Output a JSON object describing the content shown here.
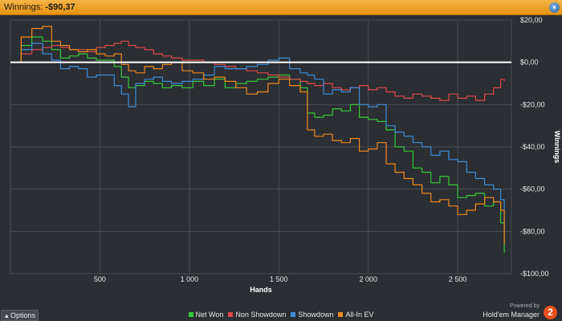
{
  "window": {
    "title_prefix": "Winnings: ",
    "title_value": "-$90,37"
  },
  "options_button": {
    "label": "Options",
    "icon": "caret-up-icon"
  },
  "branding": {
    "powered_by": "Powered by",
    "name": "Hold'em Manager",
    "logo_text": "2"
  },
  "chart_data": {
    "type": "line",
    "xlabel": "Hands",
    "ylabel": "Winnings",
    "xlim": [
      0,
      2800
    ],
    "ylim": [
      -100,
      20
    ],
    "x_ticks": [
      500,
      1000,
      1500,
      2000,
      2500
    ],
    "x_tick_labels": [
      "500",
      "1 000",
      "1 500",
      "2 000",
      "2 500"
    ],
    "y_ticks": [
      20,
      0,
      -20,
      -40,
      -60,
      -80,
      -100
    ],
    "y_tick_labels": [
      "$20,00",
      "$0,00",
      "-$20,00",
      "-$40,00",
      "-$60,00",
      "-$80,00",
      "-$100,00"
    ],
    "zero_line": true,
    "grid": true,
    "legend_position": "bottom",
    "series": [
      {
        "name": "Net Won",
        "color": "#36c93a",
        "x": [
          0,
          60,
          120,
          180,
          230,
          280,
          330,
          380,
          430,
          480,
          530,
          580,
          620,
          660,
          700,
          750,
          800,
          850,
          900,
          960,
          1020,
          1080,
          1140,
          1200,
          1260,
          1320,
          1380,
          1440,
          1500,
          1560,
          1620,
          1660,
          1700,
          1750,
          1800,
          1850,
          1900,
          1950,
          2000,
          2050,
          2100,
          2150,
          2200,
          2250,
          2300,
          2350,
          2400,
          2450,
          2500,
          2550,
          2600,
          2650,
          2700,
          2740,
          2760
        ],
        "y": [
          0,
          8,
          12,
          10,
          6,
          2,
          3,
          4,
          2,
          1,
          1,
          -2,
          -7,
          -12,
          -11,
          -9,
          -10,
          -12,
          -11,
          -12,
          -9,
          -11,
          -8,
          -12,
          -10,
          -9,
          -8,
          -7,
          -6,
          -8,
          -12,
          -24,
          -26,
          -25,
          -22,
          -23,
          -20,
          -26,
          -27,
          -28,
          -32,
          -40,
          -42,
          -50,
          -52,
          -57,
          -54,
          -58,
          -64,
          -63,
          -62,
          -68,
          -66,
          -76,
          -90
        ]
      },
      {
        "name": "Non Showdown",
        "color": "#e04a4a",
        "x": [
          0,
          60,
          120,
          180,
          230,
          280,
          330,
          380,
          430,
          480,
          530,
          580,
          620,
          660,
          700,
          750,
          800,
          850,
          900,
          960,
          1020,
          1080,
          1140,
          1200,
          1260,
          1320,
          1380,
          1440,
          1500,
          1560,
          1620,
          1660,
          1700,
          1750,
          1800,
          1850,
          1900,
          1950,
          2000,
          2050,
          2100,
          2150,
          2200,
          2250,
          2300,
          2350,
          2400,
          2450,
          2500,
          2550,
          2600,
          2650,
          2700,
          2740,
          2760
        ],
        "y": [
          0,
          4,
          6,
          7,
          8,
          7,
          6,
          6,
          5,
          7,
          8,
          9,
          10,
          8,
          7,
          6,
          4,
          3,
          2,
          1,
          1,
          0,
          -1,
          -2,
          -3,
          -4,
          -5,
          -6,
          -7,
          -8,
          -9,
          -10,
          -11,
          -10,
          -12,
          -13,
          -12,
          -11,
          -13,
          -12,
          -14,
          -16,
          -17,
          -15,
          -16,
          -17,
          -18,
          -15,
          -17,
          -16,
          -18,
          -15,
          -12,
          -8,
          -9
        ]
      },
      {
        "name": "Showdown",
        "color": "#3d8edb",
        "x": [
          0,
          60,
          120,
          180,
          230,
          280,
          330,
          380,
          430,
          480,
          530,
          580,
          620,
          660,
          700,
          750,
          800,
          850,
          900,
          960,
          1020,
          1080,
          1140,
          1200,
          1260,
          1320,
          1380,
          1440,
          1500,
          1560,
          1620,
          1660,
          1700,
          1750,
          1800,
          1850,
          1900,
          1950,
          2000,
          2050,
          2100,
          2150,
          2200,
          2250,
          2300,
          2350,
          2400,
          2450,
          2500,
          2550,
          2600,
          2650,
          2700,
          2740,
          2760
        ],
        "y": [
          0,
          6,
          9,
          4,
          1,
          -3,
          -2,
          -3,
          -7,
          -6,
          -6,
          -11,
          -15,
          -21,
          -10,
          -8,
          -7,
          -9,
          -10,
          -9,
          -8,
          -6,
          -2,
          -3,
          -3,
          -2,
          -1,
          1,
          2,
          -3,
          -5,
          -6,
          -8,
          -15,
          -13,
          -14,
          -12,
          -20,
          -21,
          -20,
          -30,
          -33,
          -35,
          -38,
          -40,
          -44,
          -42,
          -46,
          -47,
          -52,
          -55,
          -58,
          -60,
          -65,
          -82
        ]
      },
      {
        "name": "All-In EV",
        "color": "#f08a1e",
        "x": [
          0,
          60,
          120,
          180,
          230,
          280,
          330,
          380,
          430,
          480,
          530,
          580,
          620,
          660,
          700,
          750,
          800,
          850,
          900,
          960,
          1020,
          1080,
          1140,
          1200,
          1260,
          1320,
          1380,
          1440,
          1500,
          1560,
          1620,
          1660,
          1700,
          1750,
          1800,
          1850,
          1900,
          1950,
          2000,
          2050,
          2100,
          2150,
          2200,
          2250,
          2300,
          2350,
          2400,
          2450,
          2500,
          2550,
          2600,
          2650,
          2700,
          2740,
          2760
        ],
        "y": [
          0,
          12,
          16,
          17,
          10,
          8,
          6,
          5,
          6,
          4,
          3,
          4,
          -1,
          -4,
          -5,
          -2,
          -3,
          -1,
          0,
          -4,
          -5,
          -8,
          -7,
          -9,
          -12,
          -15,
          -14,
          -10,
          -8,
          -11,
          -14,
          -32,
          -35,
          -34,
          -37,
          -38,
          -36,
          -42,
          -41,
          -38,
          -48,
          -52,
          -55,
          -58,
          -62,
          -66,
          -65,
          -68,
          -72,
          -70,
          -67,
          -64,
          -66,
          -70,
          -86
        ]
      }
    ]
  }
}
